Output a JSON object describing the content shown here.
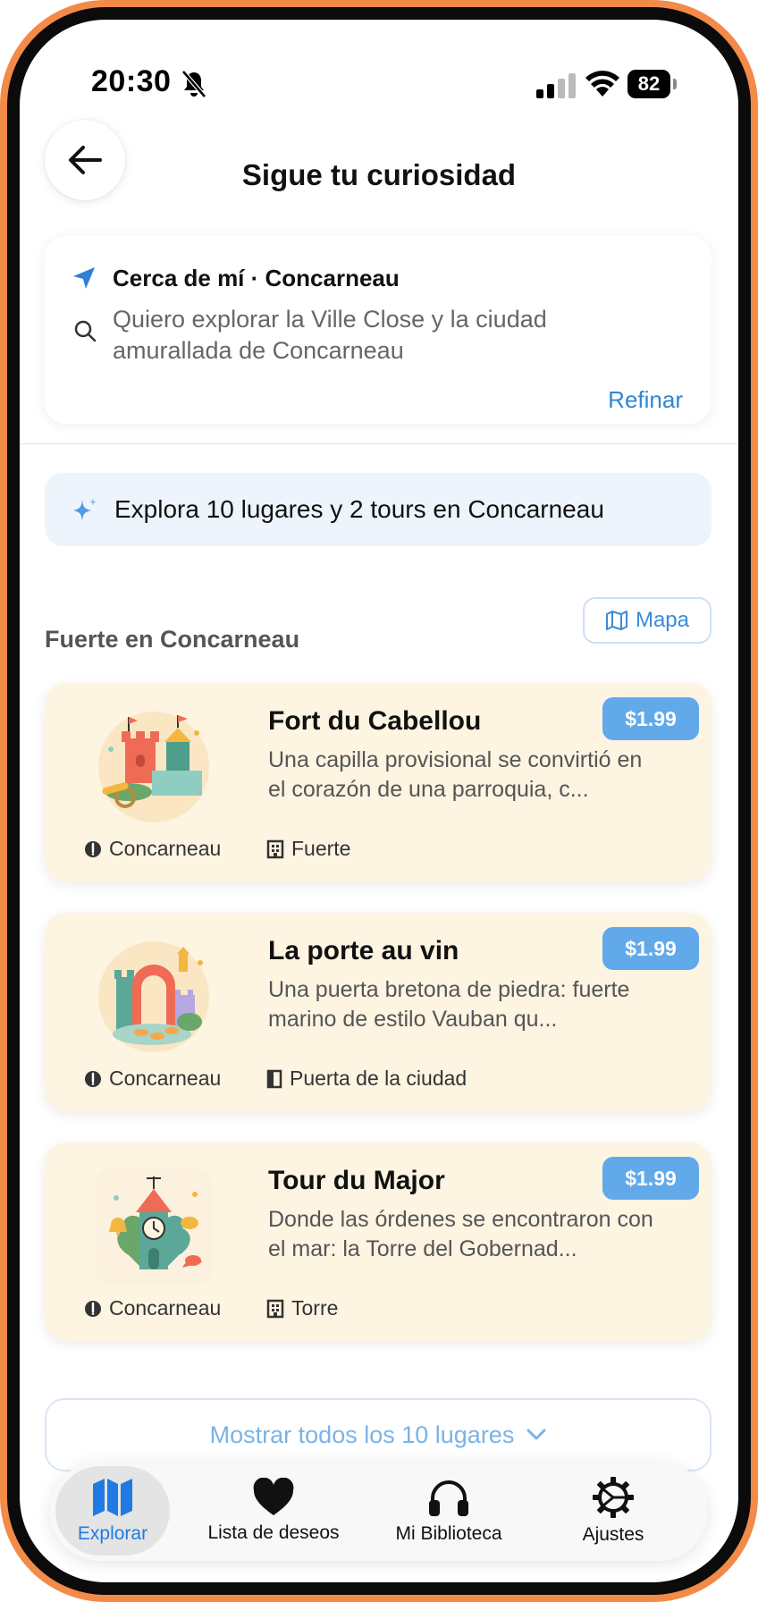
{
  "status": {
    "time": "20:30",
    "battery": "82"
  },
  "header": {
    "title": "Sigue tu curiosidad"
  },
  "search": {
    "location": "Cerca de mí · Concarneau",
    "query": "Quiero explorar la Ville Close y la ciudad amurallada de Concarneau",
    "refine_label": "Refinar"
  },
  "banner": {
    "text": "Explora 10 lugares y 2 tours en Concarneau"
  },
  "section": {
    "title": "Fuerte en Concarneau",
    "map_label": "Mapa"
  },
  "places": [
    {
      "title": "Fort du Cabellou",
      "description": "Una capilla provisional se convirtió en el corazón de una parroquia, c...",
      "price": "$1.99",
      "location": "Concarneau",
      "type": "Fuerte",
      "type_icon": "building-icon"
    },
    {
      "title": "La porte au vin",
      "description": "Una puerta bretona de piedra: fuerte marino de estilo Vauban qu...",
      "price": "$1.99",
      "location": "Concarneau",
      "type": "Puerta de la ciudad",
      "type_icon": "door-icon"
    },
    {
      "title": "Tour du Major",
      "description": "Donde las órdenes se encontraron con el mar: la Torre del Gobernad...",
      "price": "$1.99",
      "location": "Concarneau",
      "type": "Torre",
      "type_icon": "building-icon"
    }
  ],
  "show_all_label": "Mostrar todos los 10 lugares",
  "tabs": [
    {
      "label": "Explorar",
      "icon": "map-icon",
      "active": true
    },
    {
      "label": "Lista de deseos",
      "icon": "heart-icon",
      "active": false
    },
    {
      "label": "Mi Biblioteca",
      "icon": "headphones-icon",
      "active": false
    },
    {
      "label": "Ajustes",
      "icon": "gear-icon",
      "active": false
    }
  ],
  "colors": {
    "accent": "#2F86D6",
    "card_bg": "#FDF4E2",
    "price_bg": "#62A9EA",
    "frame": "#F28A48",
    "banner_bg": "#EEF4FC"
  }
}
